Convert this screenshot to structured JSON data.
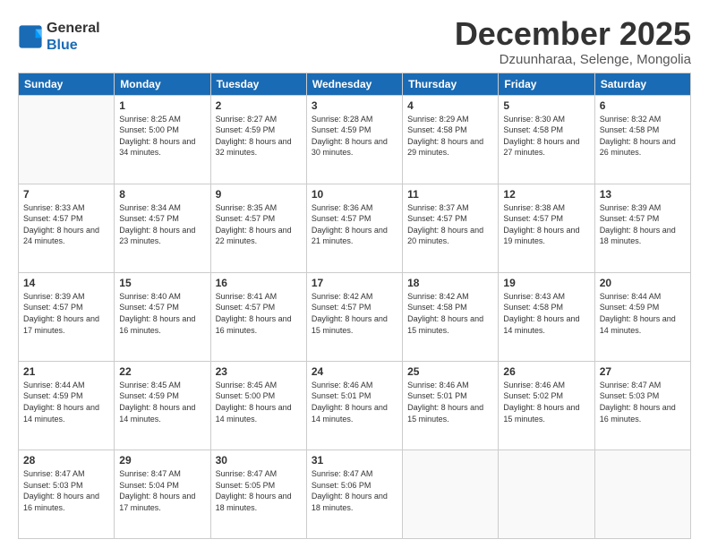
{
  "logo": {
    "line1": "General",
    "line2": "Blue"
  },
  "title": "December 2025",
  "subtitle": "Dzuunharaa, Selenge, Mongolia",
  "days_header": [
    "Sunday",
    "Monday",
    "Tuesday",
    "Wednesday",
    "Thursday",
    "Friday",
    "Saturday"
  ],
  "weeks": [
    [
      {
        "day": "",
        "sunrise": "",
        "sunset": "",
        "daylight": ""
      },
      {
        "day": "1",
        "sunrise": "Sunrise: 8:25 AM",
        "sunset": "Sunset: 5:00 PM",
        "daylight": "Daylight: 8 hours and 34 minutes."
      },
      {
        "day": "2",
        "sunrise": "Sunrise: 8:27 AM",
        "sunset": "Sunset: 4:59 PM",
        "daylight": "Daylight: 8 hours and 32 minutes."
      },
      {
        "day": "3",
        "sunrise": "Sunrise: 8:28 AM",
        "sunset": "Sunset: 4:59 PM",
        "daylight": "Daylight: 8 hours and 30 minutes."
      },
      {
        "day": "4",
        "sunrise": "Sunrise: 8:29 AM",
        "sunset": "Sunset: 4:58 PM",
        "daylight": "Daylight: 8 hours and 29 minutes."
      },
      {
        "day": "5",
        "sunrise": "Sunrise: 8:30 AM",
        "sunset": "Sunset: 4:58 PM",
        "daylight": "Daylight: 8 hours and 27 minutes."
      },
      {
        "day": "6",
        "sunrise": "Sunrise: 8:32 AM",
        "sunset": "Sunset: 4:58 PM",
        "daylight": "Daylight: 8 hours and 26 minutes."
      }
    ],
    [
      {
        "day": "7",
        "sunrise": "Sunrise: 8:33 AM",
        "sunset": "Sunset: 4:57 PM",
        "daylight": "Daylight: 8 hours and 24 minutes."
      },
      {
        "day": "8",
        "sunrise": "Sunrise: 8:34 AM",
        "sunset": "Sunset: 4:57 PM",
        "daylight": "Daylight: 8 hours and 23 minutes."
      },
      {
        "day": "9",
        "sunrise": "Sunrise: 8:35 AM",
        "sunset": "Sunset: 4:57 PM",
        "daylight": "Daylight: 8 hours and 22 minutes."
      },
      {
        "day": "10",
        "sunrise": "Sunrise: 8:36 AM",
        "sunset": "Sunset: 4:57 PM",
        "daylight": "Daylight: 8 hours and 21 minutes."
      },
      {
        "day": "11",
        "sunrise": "Sunrise: 8:37 AM",
        "sunset": "Sunset: 4:57 PM",
        "daylight": "Daylight: 8 hours and 20 minutes."
      },
      {
        "day": "12",
        "sunrise": "Sunrise: 8:38 AM",
        "sunset": "Sunset: 4:57 PM",
        "daylight": "Daylight: 8 hours and 19 minutes."
      },
      {
        "day": "13",
        "sunrise": "Sunrise: 8:39 AM",
        "sunset": "Sunset: 4:57 PM",
        "daylight": "Daylight: 8 hours and 18 minutes."
      }
    ],
    [
      {
        "day": "14",
        "sunrise": "Sunrise: 8:39 AM",
        "sunset": "Sunset: 4:57 PM",
        "daylight": "Daylight: 8 hours and 17 minutes."
      },
      {
        "day": "15",
        "sunrise": "Sunrise: 8:40 AM",
        "sunset": "Sunset: 4:57 PM",
        "daylight": "Daylight: 8 hours and 16 minutes."
      },
      {
        "day": "16",
        "sunrise": "Sunrise: 8:41 AM",
        "sunset": "Sunset: 4:57 PM",
        "daylight": "Daylight: 8 hours and 16 minutes."
      },
      {
        "day": "17",
        "sunrise": "Sunrise: 8:42 AM",
        "sunset": "Sunset: 4:57 PM",
        "daylight": "Daylight: 8 hours and 15 minutes."
      },
      {
        "day": "18",
        "sunrise": "Sunrise: 8:42 AM",
        "sunset": "Sunset: 4:58 PM",
        "daylight": "Daylight: 8 hours and 15 minutes."
      },
      {
        "day": "19",
        "sunrise": "Sunrise: 8:43 AM",
        "sunset": "Sunset: 4:58 PM",
        "daylight": "Daylight: 8 hours and 14 minutes."
      },
      {
        "day": "20",
        "sunrise": "Sunrise: 8:44 AM",
        "sunset": "Sunset: 4:59 PM",
        "daylight": "Daylight: 8 hours and 14 minutes."
      }
    ],
    [
      {
        "day": "21",
        "sunrise": "Sunrise: 8:44 AM",
        "sunset": "Sunset: 4:59 PM",
        "daylight": "Daylight: 8 hours and 14 minutes."
      },
      {
        "day": "22",
        "sunrise": "Sunrise: 8:45 AM",
        "sunset": "Sunset: 4:59 PM",
        "daylight": "Daylight: 8 hours and 14 minutes."
      },
      {
        "day": "23",
        "sunrise": "Sunrise: 8:45 AM",
        "sunset": "Sunset: 5:00 PM",
        "daylight": "Daylight: 8 hours and 14 minutes."
      },
      {
        "day": "24",
        "sunrise": "Sunrise: 8:46 AM",
        "sunset": "Sunset: 5:01 PM",
        "daylight": "Daylight: 8 hours and 14 minutes."
      },
      {
        "day": "25",
        "sunrise": "Sunrise: 8:46 AM",
        "sunset": "Sunset: 5:01 PM",
        "daylight": "Daylight: 8 hours and 15 minutes."
      },
      {
        "day": "26",
        "sunrise": "Sunrise: 8:46 AM",
        "sunset": "Sunset: 5:02 PM",
        "daylight": "Daylight: 8 hours and 15 minutes."
      },
      {
        "day": "27",
        "sunrise": "Sunrise: 8:47 AM",
        "sunset": "Sunset: 5:03 PM",
        "daylight": "Daylight: 8 hours and 16 minutes."
      }
    ],
    [
      {
        "day": "28",
        "sunrise": "Sunrise: 8:47 AM",
        "sunset": "Sunset: 5:03 PM",
        "daylight": "Daylight: 8 hours and 16 minutes."
      },
      {
        "day": "29",
        "sunrise": "Sunrise: 8:47 AM",
        "sunset": "Sunset: 5:04 PM",
        "daylight": "Daylight: 8 hours and 17 minutes."
      },
      {
        "day": "30",
        "sunrise": "Sunrise: 8:47 AM",
        "sunset": "Sunset: 5:05 PM",
        "daylight": "Daylight: 8 hours and 18 minutes."
      },
      {
        "day": "31",
        "sunrise": "Sunrise: 8:47 AM",
        "sunset": "Sunset: 5:06 PM",
        "daylight": "Daylight: 8 hours and 18 minutes."
      },
      {
        "day": "",
        "sunrise": "",
        "sunset": "",
        "daylight": ""
      },
      {
        "day": "",
        "sunrise": "",
        "sunset": "",
        "daylight": ""
      },
      {
        "day": "",
        "sunrise": "",
        "sunset": "",
        "daylight": ""
      }
    ]
  ]
}
